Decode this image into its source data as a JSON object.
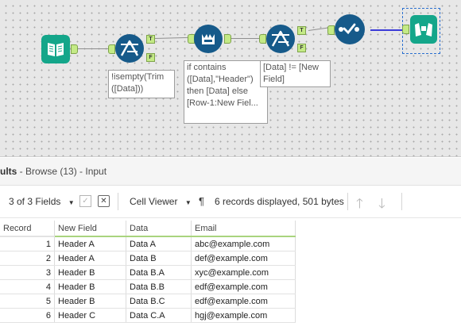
{
  "workflow": {
    "annotations": {
      "filter1": "!isempty(Trim\n([Data]))",
      "formula": "if contains\n([Data],\"Header\")\nthen [Data] else\n[Row-1:New Fiel...",
      "filter2": "[Data] != [New\nField]"
    },
    "anchor_labels": {
      "true": "T",
      "false": "F"
    }
  },
  "results": {
    "title": "ults",
    "subtitle": " - Browse (13) - Input",
    "fields_label": "3 of 3 Fields",
    "viewer_label": "Cell Viewer",
    "pilcrow": "¶",
    "records_info": "6 records displayed, 501 bytes"
  },
  "grid": {
    "columns": [
      "Record",
      "New Field",
      "Data",
      "Email"
    ],
    "rows": [
      [
        "1",
        "Header A",
        "Data A",
        "abc@example.com"
      ],
      [
        "2",
        "Header A",
        "Data B",
        "def@example.com"
      ],
      [
        "3",
        "Header B",
        "Data B.A",
        "xyc@example.com"
      ],
      [
        "4",
        "Header B",
        "Data B.B",
        "edf@example.com"
      ],
      [
        "5",
        "Header B",
        "Data B.C",
        "edf@example.com"
      ],
      [
        "6",
        "Header C",
        "Data C.A",
        "hgj@example.com"
      ]
    ]
  },
  "colors": {
    "tool_blue": "#165a8a",
    "input_green": "#14a68a",
    "browse_green": "#14a68a",
    "anchor_green": "#c4ea86",
    "wire_blue": "#3b3bd8"
  }
}
